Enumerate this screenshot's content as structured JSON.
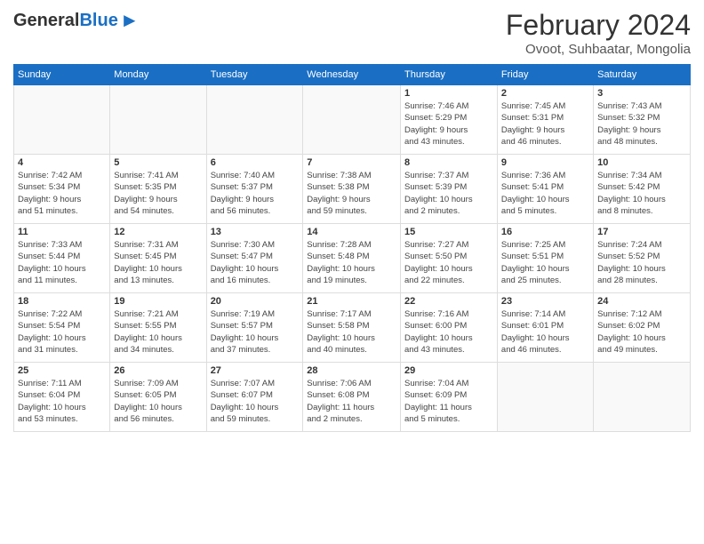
{
  "header": {
    "logo_general": "General",
    "logo_blue": "Blue",
    "title": "February 2024",
    "location": "Ovoot, Suhbaatar, Mongolia"
  },
  "days_of_week": [
    "Sunday",
    "Monday",
    "Tuesday",
    "Wednesday",
    "Thursday",
    "Friday",
    "Saturday"
  ],
  "weeks": [
    {
      "days": [
        {
          "num": "",
          "info": ""
        },
        {
          "num": "",
          "info": ""
        },
        {
          "num": "",
          "info": ""
        },
        {
          "num": "",
          "info": ""
        },
        {
          "num": "1",
          "info": "Sunrise: 7:46 AM\nSunset: 5:29 PM\nDaylight: 9 hours\nand 43 minutes."
        },
        {
          "num": "2",
          "info": "Sunrise: 7:45 AM\nSunset: 5:31 PM\nDaylight: 9 hours\nand 46 minutes."
        },
        {
          "num": "3",
          "info": "Sunrise: 7:43 AM\nSunset: 5:32 PM\nDaylight: 9 hours\nand 48 minutes."
        }
      ]
    },
    {
      "days": [
        {
          "num": "4",
          "info": "Sunrise: 7:42 AM\nSunset: 5:34 PM\nDaylight: 9 hours\nand 51 minutes."
        },
        {
          "num": "5",
          "info": "Sunrise: 7:41 AM\nSunset: 5:35 PM\nDaylight: 9 hours\nand 54 minutes."
        },
        {
          "num": "6",
          "info": "Sunrise: 7:40 AM\nSunset: 5:37 PM\nDaylight: 9 hours\nand 56 minutes."
        },
        {
          "num": "7",
          "info": "Sunrise: 7:38 AM\nSunset: 5:38 PM\nDaylight: 9 hours\nand 59 minutes."
        },
        {
          "num": "8",
          "info": "Sunrise: 7:37 AM\nSunset: 5:39 PM\nDaylight: 10 hours\nand 2 minutes."
        },
        {
          "num": "9",
          "info": "Sunrise: 7:36 AM\nSunset: 5:41 PM\nDaylight: 10 hours\nand 5 minutes."
        },
        {
          "num": "10",
          "info": "Sunrise: 7:34 AM\nSunset: 5:42 PM\nDaylight: 10 hours\nand 8 minutes."
        }
      ]
    },
    {
      "days": [
        {
          "num": "11",
          "info": "Sunrise: 7:33 AM\nSunset: 5:44 PM\nDaylight: 10 hours\nand 11 minutes."
        },
        {
          "num": "12",
          "info": "Sunrise: 7:31 AM\nSunset: 5:45 PM\nDaylight: 10 hours\nand 13 minutes."
        },
        {
          "num": "13",
          "info": "Sunrise: 7:30 AM\nSunset: 5:47 PM\nDaylight: 10 hours\nand 16 minutes."
        },
        {
          "num": "14",
          "info": "Sunrise: 7:28 AM\nSunset: 5:48 PM\nDaylight: 10 hours\nand 19 minutes."
        },
        {
          "num": "15",
          "info": "Sunrise: 7:27 AM\nSunset: 5:50 PM\nDaylight: 10 hours\nand 22 minutes."
        },
        {
          "num": "16",
          "info": "Sunrise: 7:25 AM\nSunset: 5:51 PM\nDaylight: 10 hours\nand 25 minutes."
        },
        {
          "num": "17",
          "info": "Sunrise: 7:24 AM\nSunset: 5:52 PM\nDaylight: 10 hours\nand 28 minutes."
        }
      ]
    },
    {
      "days": [
        {
          "num": "18",
          "info": "Sunrise: 7:22 AM\nSunset: 5:54 PM\nDaylight: 10 hours\nand 31 minutes."
        },
        {
          "num": "19",
          "info": "Sunrise: 7:21 AM\nSunset: 5:55 PM\nDaylight: 10 hours\nand 34 minutes."
        },
        {
          "num": "20",
          "info": "Sunrise: 7:19 AM\nSunset: 5:57 PM\nDaylight: 10 hours\nand 37 minutes."
        },
        {
          "num": "21",
          "info": "Sunrise: 7:17 AM\nSunset: 5:58 PM\nDaylight: 10 hours\nand 40 minutes."
        },
        {
          "num": "22",
          "info": "Sunrise: 7:16 AM\nSunset: 6:00 PM\nDaylight: 10 hours\nand 43 minutes."
        },
        {
          "num": "23",
          "info": "Sunrise: 7:14 AM\nSunset: 6:01 PM\nDaylight: 10 hours\nand 46 minutes."
        },
        {
          "num": "24",
          "info": "Sunrise: 7:12 AM\nSunset: 6:02 PM\nDaylight: 10 hours\nand 49 minutes."
        }
      ]
    },
    {
      "days": [
        {
          "num": "25",
          "info": "Sunrise: 7:11 AM\nSunset: 6:04 PM\nDaylight: 10 hours\nand 53 minutes."
        },
        {
          "num": "26",
          "info": "Sunrise: 7:09 AM\nSunset: 6:05 PM\nDaylight: 10 hours\nand 56 minutes."
        },
        {
          "num": "27",
          "info": "Sunrise: 7:07 AM\nSunset: 6:07 PM\nDaylight: 10 hours\nand 59 minutes."
        },
        {
          "num": "28",
          "info": "Sunrise: 7:06 AM\nSunset: 6:08 PM\nDaylight: 11 hours\nand 2 minutes."
        },
        {
          "num": "29",
          "info": "Sunrise: 7:04 AM\nSunset: 6:09 PM\nDaylight: 11 hours\nand 5 minutes."
        },
        {
          "num": "",
          "info": ""
        },
        {
          "num": "",
          "info": ""
        }
      ]
    }
  ]
}
